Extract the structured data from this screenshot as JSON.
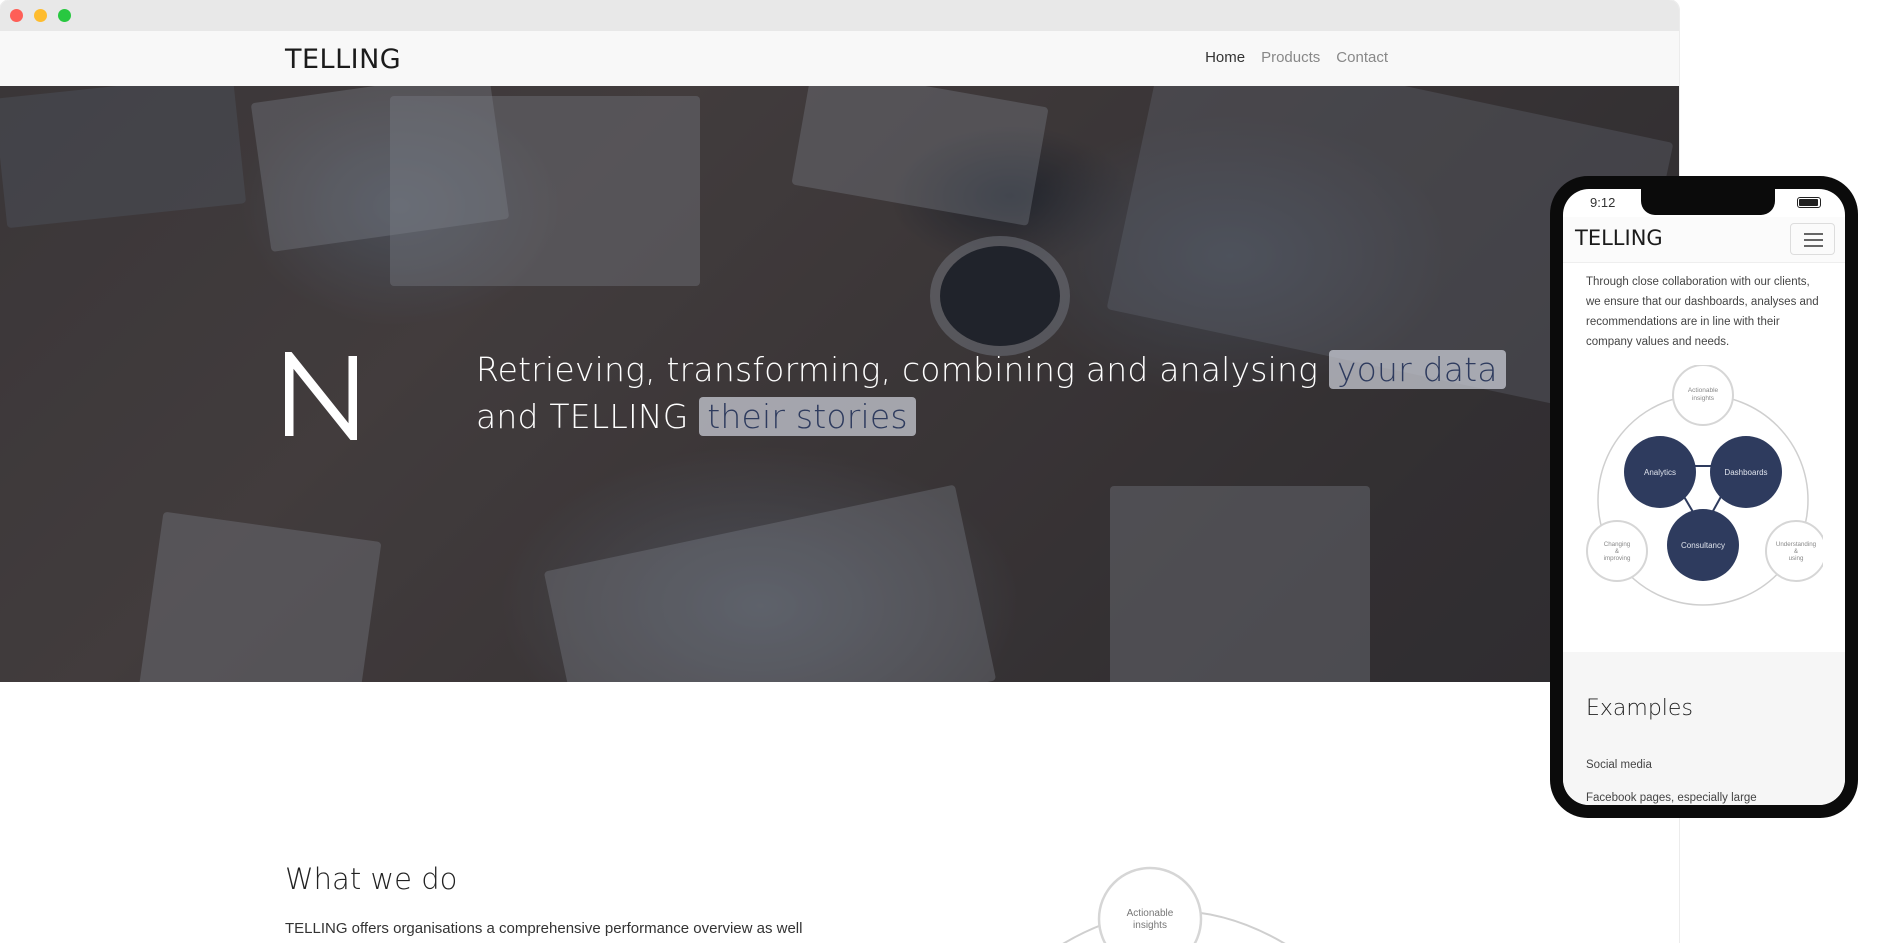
{
  "browser": {
    "window_controls": [
      "close",
      "minimize",
      "maximize"
    ]
  },
  "nav": {
    "logo": "TELLING",
    "links": [
      "Home",
      "Products",
      "Contact"
    ]
  },
  "hero": {
    "line1_prefix": "Retrieving, transforming, combining and analysing",
    "line1_highlight": "your data",
    "line2_prefix": "and TELLING",
    "line2_highlight": "their stories",
    "icon": "telling-monogram-icon"
  },
  "section": {
    "title": "What we do",
    "body": "TELLING offers organisations a comprehensive performance overview as well",
    "diagram_label": "Actionable insights"
  },
  "mobile": {
    "time": "9:12",
    "logo": "TELLING",
    "menu_icon": "hamburger-icon",
    "paragraph": "Through close collaboration with our clients, we ensure that our dashboards, analyses and recommendations are in line with their company values and needs.",
    "diagram": {
      "top": "Actionable insights",
      "left_outer": "Changing & improving",
      "right_outer": "Understanding & using",
      "analytics": "Analytics",
      "dashboards": "Dashboards",
      "consultancy": "Consultancy"
    },
    "examples_title": "Examples",
    "example_item": "Social media",
    "example_sub": "Facebook pages, especially large"
  }
}
